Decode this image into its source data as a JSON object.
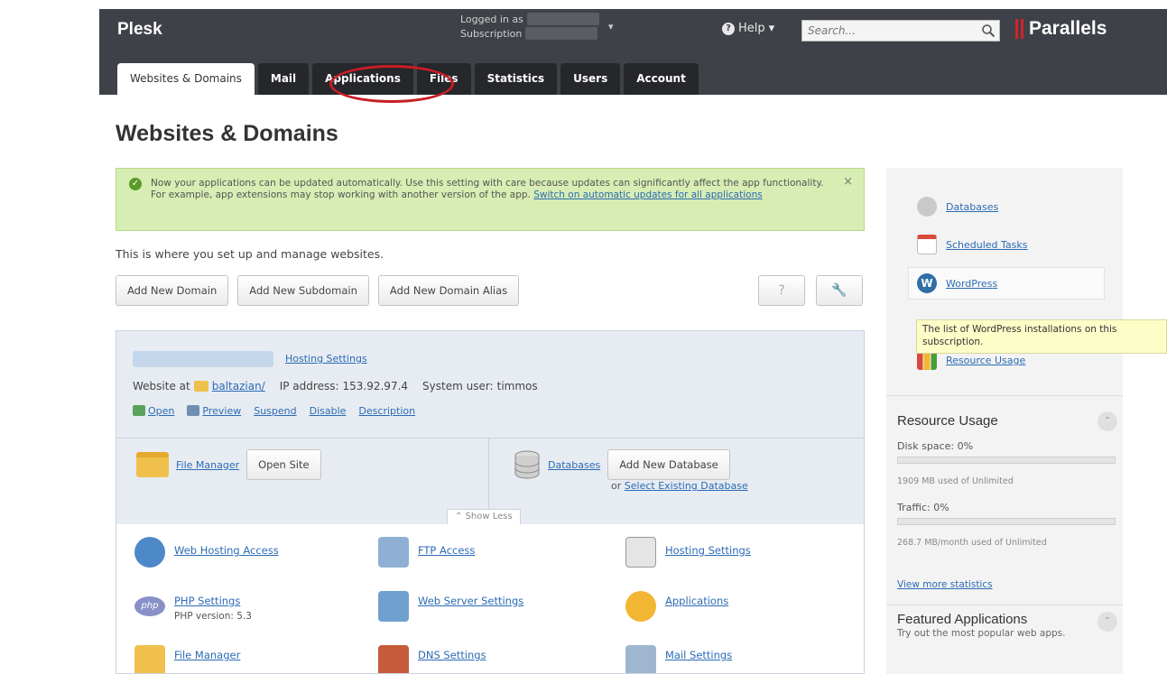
{
  "header": {
    "brand": "Plesk",
    "logged_in_label": "Logged in as",
    "subscription_label": "Subscription",
    "help_label": "Help",
    "search_placeholder": "Search...",
    "vendor": "Parallels"
  },
  "tabs": [
    {
      "label": "Websites & Domains",
      "active": true
    },
    {
      "label": "Mail",
      "active": false
    },
    {
      "label": "Applications",
      "active": false
    },
    {
      "label": "Files",
      "active": false
    },
    {
      "label": "Statistics",
      "active": false
    },
    {
      "label": "Users",
      "active": false
    },
    {
      "label": "Account",
      "active": false
    }
  ],
  "page_title": "Websites & Domains",
  "notice": {
    "text": "Now your applications can be updated automatically. Use this setting with care because updates can significantly affect the app functionality. For example, app extensions may stop working with another version of the app.",
    "link": "Switch on automatic updates for all applications",
    "close": "×"
  },
  "intro": "This is where you set up and manage websites.",
  "buttons": {
    "add_domain": "Add New Domain",
    "add_subdomain": "Add New Subdomain",
    "add_alias": "Add New Domain Alias",
    "help": "?",
    "settings": "🔧"
  },
  "domain": {
    "hosting_settings": "Hosting Settings",
    "website_at": "Website at",
    "folder": "baltazian/",
    "ip_label": "IP address:",
    "ip": "153.92.97.4",
    "user_label": "System user:",
    "user": "timmos",
    "actions": {
      "open": "Open",
      "preview": "Preview",
      "suspend": "Suspend",
      "disable": "Disable",
      "description": "Description"
    },
    "file_manager": "File Manager",
    "open_site": "Open Site",
    "databases": "Databases",
    "add_db": "Add New Database",
    "or": "or",
    "select_db": "Select Existing Database",
    "show_less": "Show Less",
    "grid": {
      "web_hosting_access": "Web Hosting Access",
      "ftp_access": "FTP Access",
      "hosting_settings": "Hosting Settings",
      "php_settings": "PHP Settings",
      "php_version": "PHP version: 5.3",
      "web_server_settings": "Web Server Settings",
      "applications": "Applications",
      "file_manager": "File Manager",
      "dns_settings": "DNS Settings",
      "mail_settings": "Mail Settings"
    }
  },
  "sidebar": {
    "databases": "Databases",
    "scheduled_tasks": "Scheduled Tasks",
    "wordpress": "WordPress",
    "tooltip": "The list of WordPress installations on this subscription.",
    "resource_usage_link": "Resource Usage",
    "resource_usage_title": "Resource Usage",
    "disk_space_label": "Disk space: 0%",
    "disk_used": "1909 MB used of Unlimited",
    "disk_fraction": 0.0,
    "traffic_label": "Traffic: 0%",
    "traffic_used": "268.7 MB/month used of Unlimited",
    "traffic_fraction": 0.0,
    "view_more": "View more statistics",
    "featured_title": "Featured Applications",
    "featured_sub": "Try out the most popular web apps."
  },
  "colors": {
    "header_bg": "#3e4147",
    "tab_bg": "#25272b",
    "notice_bg": "#d7edb3",
    "link": "#2c6bb5",
    "annotation_circle": "#c81d25"
  }
}
